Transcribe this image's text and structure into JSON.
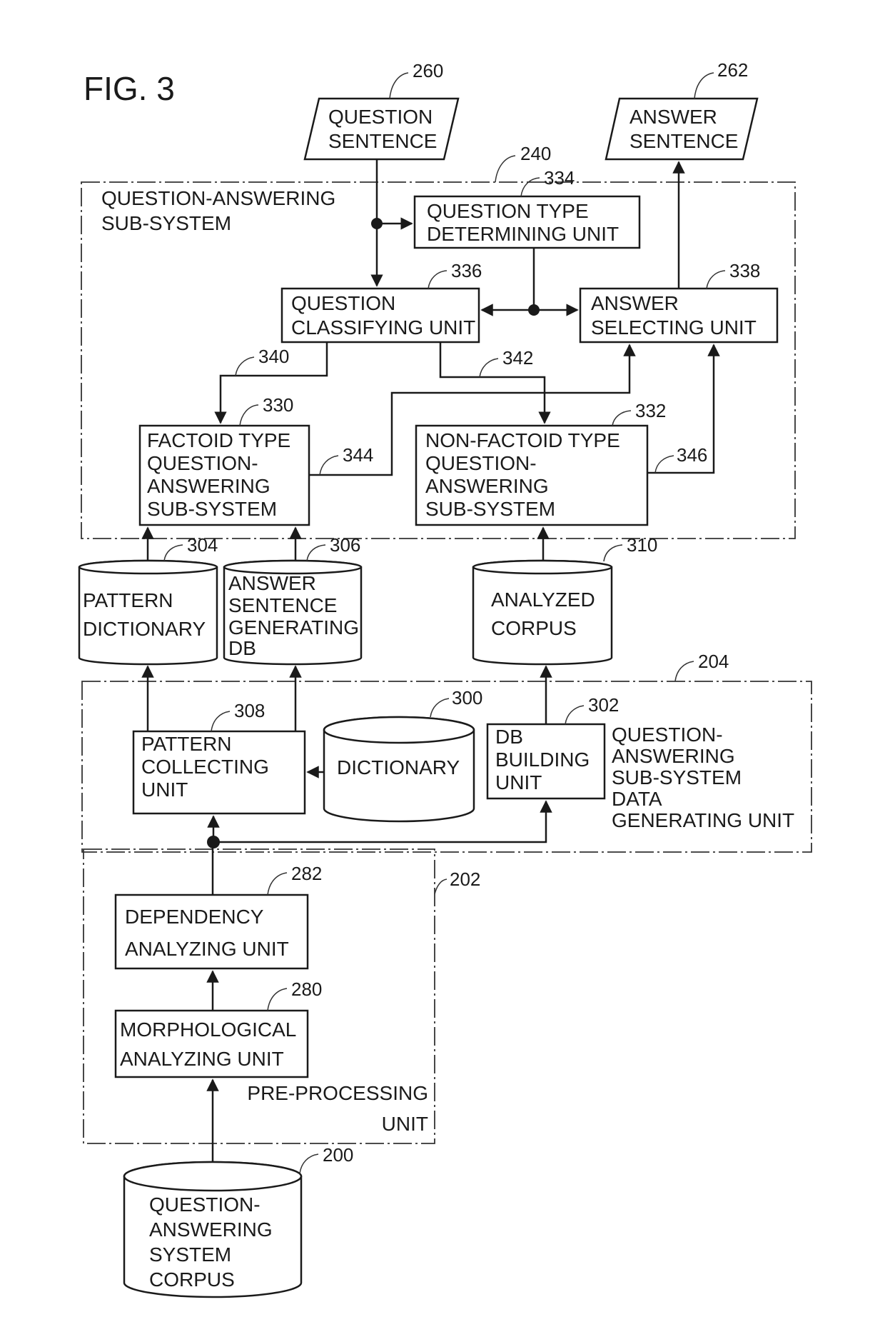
{
  "figure": {
    "title": "FIG. 3",
    "colors": {
      "ink": "#1a1a1a",
      "background": "#ffffff"
    }
  },
  "io": {
    "question_sentence": {
      "ref": "260",
      "lines": [
        "QUESTION",
        "SENTENCE"
      ]
    },
    "answer_sentence": {
      "ref": "262",
      "lines": [
        "ANSWER",
        "SENTENCE"
      ]
    }
  },
  "qa_subsystem": {
    "ref": "240",
    "label_lines": [
      "QUESTION-ANSWERING",
      "SUB-SYSTEM"
    ],
    "question_type_determining_unit": {
      "ref": "334",
      "lines": [
        "QUESTION TYPE",
        "DETERMINING UNIT"
      ]
    },
    "question_classifying_unit": {
      "ref": "336",
      "lines": [
        "QUESTION",
        "CLASSIFYING UNIT"
      ]
    },
    "answer_selecting_unit": {
      "ref": "338",
      "lines": [
        "ANSWER",
        "SELECTING UNIT"
      ]
    },
    "factoid_subsystem": {
      "ref": "330",
      "lines": [
        "FACTOID TYPE",
        "QUESTION-",
        "ANSWERING",
        "SUB-SYSTEM"
      ]
    },
    "non_factoid_subsystem": {
      "ref": "332",
      "lines": [
        "NON-FACTOID TYPE",
        "QUESTION-",
        "ANSWERING",
        "SUB-SYSTEM"
      ]
    },
    "connections": {
      "c340": "340",
      "c342": "342",
      "c344": "344",
      "c346": "346"
    }
  },
  "databases": {
    "pattern_dictionary": {
      "ref": "304",
      "lines": [
        "PATTERN",
        "DICTIONARY"
      ]
    },
    "answer_sentence_generating_db": {
      "ref": "306",
      "lines": [
        "ANSWER",
        "SENTENCE",
        "GENERATING",
        "DB"
      ]
    },
    "analyzed_corpus": {
      "ref": "310",
      "lines": [
        "ANALYZED",
        "CORPUS"
      ]
    }
  },
  "data_generating_unit": {
    "ref": "204",
    "label_lines": [
      "QUESTION-",
      "ANSWERING",
      "SUB-SYSTEM",
      "DATA",
      "GENERATING UNIT"
    ],
    "pattern_collecting_unit": {
      "ref": "308",
      "lines": [
        "PATTERN",
        "COLLECTING",
        "UNIT"
      ]
    },
    "dictionary": {
      "ref": "300",
      "lines": [
        "DICTIONARY"
      ]
    },
    "db_building_unit": {
      "ref": "302",
      "lines": [
        "DB",
        "BUILDING",
        "UNIT"
      ]
    }
  },
  "preprocessing_unit": {
    "ref": "202",
    "label_lines": [
      "PRE-PROCESSING",
      "UNIT"
    ],
    "dependency_analyzing_unit": {
      "ref": "282",
      "lines": [
        "DEPENDENCY",
        "ANALYZING UNIT"
      ]
    },
    "morphological_analyzing_unit": {
      "ref": "280",
      "lines": [
        "MORPHOLOGICAL",
        "ANALYZING UNIT"
      ]
    }
  },
  "corpus": {
    "ref": "200",
    "lines": [
      "QUESTION-",
      "ANSWERING",
      "SYSTEM",
      "CORPUS"
    ]
  }
}
